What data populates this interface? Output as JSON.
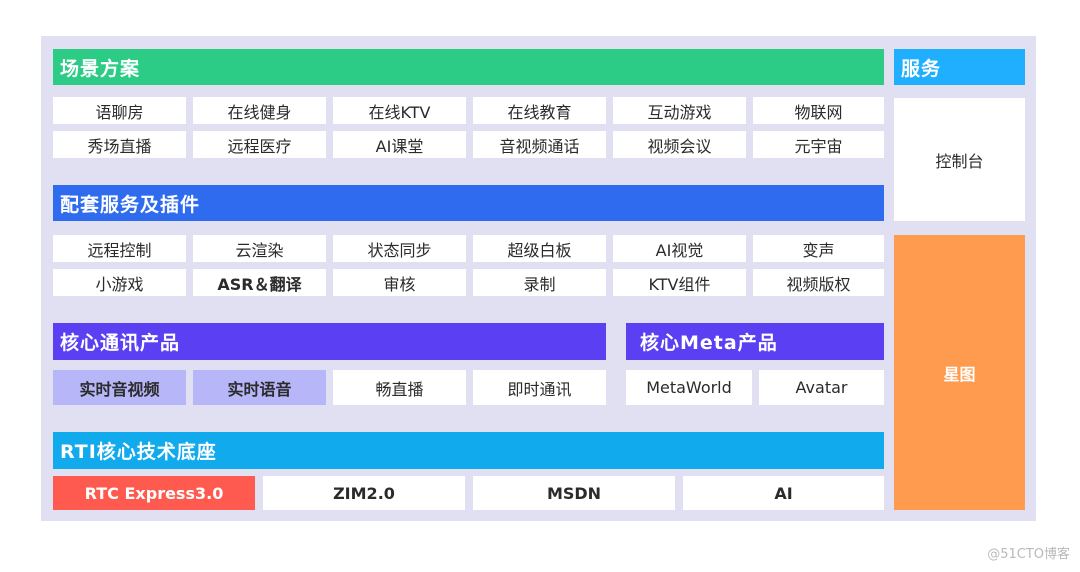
{
  "scenarios": {
    "title": "场景方案",
    "rows": [
      [
        "语聊房",
        "在线健身",
        "在线KTV",
        "在线教育",
        "互动游戏",
        "物联网"
      ],
      [
        "秀场直播",
        "远程医疗",
        "AI课堂",
        "音视频通话",
        "视频会议",
        "元宇宙"
      ]
    ]
  },
  "plugins": {
    "title": "配套服务及插件",
    "rows": [
      [
        "远程控制",
        "云渲染",
        "状态同步",
        "超级白板",
        "AI视觉",
        "变声"
      ],
      [
        "小游戏",
        "ASR＆翻译",
        "审核",
        "录制",
        "KTV组件",
        "视频版权"
      ]
    ]
  },
  "core_comm": {
    "title": "核心通讯产品",
    "items": [
      "实时音视频",
      "实时语音",
      "畅直播",
      "即时通讯"
    ]
  },
  "core_meta": {
    "title": "核心Meta产品",
    "items": [
      "MetaWorld",
      "Avatar"
    ]
  },
  "rti": {
    "title": "RTI核心技术底座",
    "items": [
      "RTC Express3.0",
      "ZIM2.0",
      "MSDN",
      "AI"
    ]
  },
  "services": {
    "title": "服务",
    "console": "控制台",
    "star_map": "星图"
  },
  "watermark": "@51CTO博客",
  "colors": {
    "scenarios": "#2ccc86",
    "plugins": "#2f6bef",
    "core": "#5b40f3",
    "rti": "#11aaec",
    "services": "#20afff",
    "star_map": "#ff9b4f",
    "highlight": "#b7b6f8",
    "rtc": "#fe5a4f"
  }
}
